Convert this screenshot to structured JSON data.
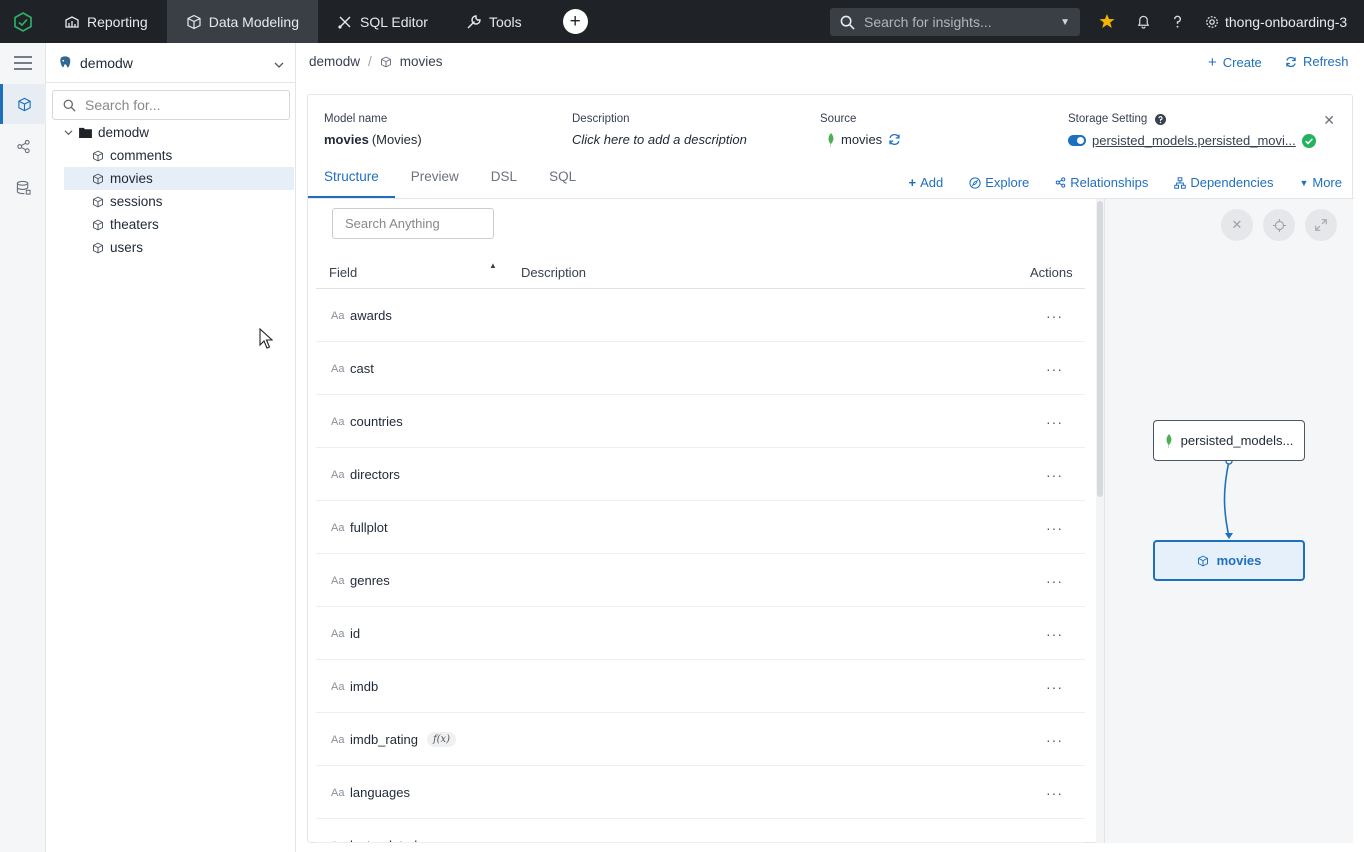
{
  "topnav": {
    "tabs": [
      {
        "label": "Reporting",
        "icon": "reporting-icon"
      },
      {
        "label": "Data Modeling",
        "icon": "cube-icon"
      },
      {
        "label": "SQL Editor",
        "icon": "sql-editor-icon"
      },
      {
        "label": "Tools",
        "icon": "wrench-icon"
      }
    ],
    "search_placeholder": "Search for insights...",
    "workspace": "thong-onboarding-3"
  },
  "tree": {
    "datasource": "demodw",
    "search_placeholder": "Search for...",
    "folder": "demodw",
    "items": [
      "comments",
      "movies",
      "sessions",
      "theaters",
      "users"
    ],
    "selected": "movies"
  },
  "breadcrumb": {
    "root": "demodw",
    "current": "movies"
  },
  "header_actions": {
    "create": "Create",
    "refresh": "Refresh"
  },
  "model": {
    "name_label": "Model name",
    "name": "movies",
    "name_alias": "(Movies)",
    "description_label": "Description",
    "description_placeholder": "Click here to add a description",
    "source_label": "Source",
    "source": "movies",
    "storage_label": "Storage Setting",
    "storage_value": "persisted_models.persisted_movi..."
  },
  "tabs": [
    "Structure",
    "Preview",
    "DSL",
    "SQL"
  ],
  "active_tab": "Structure",
  "card_actions": {
    "add": "Add",
    "explore": "Explore",
    "relationships": "Relationships",
    "dependencies": "Dependencies",
    "more": "More"
  },
  "table": {
    "search_placeholder": "Search Anything",
    "columns": {
      "field": "Field",
      "description": "Description",
      "actions": "Actions"
    },
    "type_glyph": "Aa",
    "fx_badge": "f(x)",
    "rows": [
      {
        "name": "awards",
        "fx": false
      },
      {
        "name": "cast",
        "fx": false
      },
      {
        "name": "countries",
        "fx": false
      },
      {
        "name": "directors",
        "fx": false
      },
      {
        "name": "fullplot",
        "fx": false
      },
      {
        "name": "genres",
        "fx": false
      },
      {
        "name": "id",
        "fx": false
      },
      {
        "name": "imdb",
        "fx": false
      },
      {
        "name": "imdb_rating",
        "fx": true
      },
      {
        "name": "languages",
        "fx": false
      },
      {
        "name": "lastupdated",
        "fx": false
      }
    ]
  },
  "lineage": {
    "source_node": "persisted_models...",
    "model_node": "movies"
  },
  "colors": {
    "accent": "#1f6fbf",
    "nav_bg": "#1f2327",
    "mongo_green": "#4caf50",
    "star": "#f5b400",
    "success": "#22b35e"
  }
}
